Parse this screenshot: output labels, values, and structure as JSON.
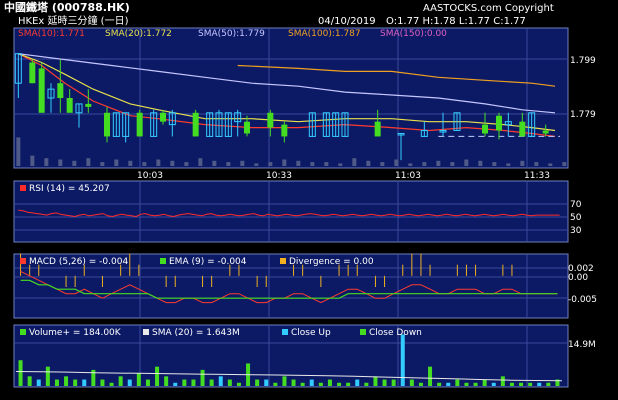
{
  "header": {
    "title": "中國鐵塔 (000788.HK)",
    "subtitle": "HKEx 延時三分鐘 (一日)",
    "copyright": "AASTOCKS.com Copyright",
    "date": "04/10/2019",
    "ohlc": "O:1.77  H:1.78  L:1.77  C:1.77"
  },
  "colors": {
    "background": "#000000",
    "panel": "#0c1a66",
    "grid": "#3a4a9a",
    "up_candle": "#33ccff",
    "down_candle": "#44dd22",
    "sma10": "#ff3b2e",
    "sma20": "#e8e04a",
    "sma50": "#c6c6ff",
    "sma100": "#f0a020",
    "sma150": "#e060c0",
    "rsi": "#ff2a2a",
    "macd": "#ff3b2e",
    "ema": "#44dd22",
    "divergence": "#f0b020",
    "volume_sma": "#e8e8e8",
    "text": "#ffffff"
  },
  "chart_data": [
    {
      "type": "candlestick",
      "title": "",
      "sma_legend": [
        {
          "label": "SMA(10):1.771",
          "color": "#ff3b2e"
        },
        {
          "label": "SMA(20):1.772",
          "color": "#e8e04a"
        },
        {
          "label": "SMA(50):1.779",
          "color": "#c6c6ff"
        },
        {
          "label": "SMA(100):1.787",
          "color": "#f0a020"
        },
        {
          "label": "SMA(150):0.00",
          "color": "#e060c0"
        }
      ],
      "x_ticks": [
        "10:03",
        "10:33",
        "11:03",
        "11:33"
      ],
      "y_ticks": [
        "1.799",
        "1.779"
      ],
      "ylim": [
        1.762,
        1.808
      ],
      "candles": [
        {
          "i": 0,
          "o": 1.79,
          "h": 1.8,
          "l": 1.785,
          "c": 1.8
        },
        {
          "i": 3,
          "o": 1.797,
          "h": 1.798,
          "l": 1.79,
          "c": 1.79
        },
        {
          "i": 5,
          "o": 1.795,
          "h": 1.797,
          "l": 1.78,
          "c": 1.78
        },
        {
          "i": 7,
          "o": 1.785,
          "h": 1.79,
          "l": 1.78,
          "c": 1.788
        },
        {
          "i": 9,
          "o": 1.79,
          "h": 1.798,
          "l": 1.78,
          "c": 1.785
        },
        {
          "i": 11,
          "o": 1.785,
          "h": 1.788,
          "l": 1.78,
          "c": 1.78
        },
        {
          "i": 13,
          "o": 1.78,
          "h": 1.783,
          "l": 1.775,
          "c": 1.783
        },
        {
          "i": 15,
          "o": 1.783,
          "h": 1.788,
          "l": 1.78,
          "c": 1.782
        },
        {
          "i": 19,
          "o": 1.78,
          "h": 1.782,
          "l": 1.77,
          "c": 1.772
        },
        {
          "i": 21,
          "o": 1.772,
          "h": 1.78,
          "l": 1.772,
          "c": 1.78
        },
        {
          "i": 23,
          "o": 1.772,
          "h": 1.78,
          "l": 1.77,
          "c": 1.78
        },
        {
          "i": 26,
          "o": 1.78,
          "h": 1.781,
          "l": 1.772,
          "c": 1.772
        },
        {
          "i": 29,
          "o": 1.772,
          "h": 1.781,
          "l": 1.772,
          "c": 1.78
        },
        {
          "i": 31,
          "o": 1.78,
          "h": 1.781,
          "l": 1.776,
          "c": 1.777
        },
        {
          "i": 33,
          "o": 1.776,
          "h": 1.781,
          "l": 1.772,
          "c": 1.78
        },
        {
          "i": 38,
          "o": 1.78,
          "h": 1.781,
          "l": 1.772,
          "c": 1.772
        },
        {
          "i": 41,
          "o": 1.772,
          "h": 1.78,
          "l": 1.772,
          "c": 1.78
        },
        {
          "i": 43,
          "o": 1.772,
          "h": 1.781,
          "l": 1.772,
          "c": 1.78
        },
        {
          "i": 45,
          "o": 1.772,
          "h": 1.78,
          "l": 1.772,
          "c": 1.78
        },
        {
          "i": 47,
          "o": 1.777,
          "h": 1.781,
          "l": 1.772,
          "c": 1.78
        },
        {
          "i": 49,
          "o": 1.777,
          "h": 1.779,
          "l": 1.772,
          "c": 1.773
        },
        {
          "i": 54,
          "o": 1.78,
          "h": 1.781,
          "l": 1.772,
          "c": 1.775
        },
        {
          "i": 57,
          "o": 1.776,
          "h": 1.777,
          "l": 1.77,
          "c": 1.772
        },
        {
          "i": 63,
          "o": 1.772,
          "h": 1.78,
          "l": 1.772,
          "c": 1.78
        },
        {
          "i": 66,
          "o": 1.772,
          "h": 1.78,
          "l": 1.772,
          "c": 1.78
        },
        {
          "i": 68,
          "o": 1.772,
          "h": 1.78,
          "l": 1.772,
          "c": 1.78
        },
        {
          "i": 70,
          "o": 1.772,
          "h": 1.78,
          "l": 1.772,
          "c": 1.78
        },
        {
          "i": 77,
          "o": 1.777,
          "h": 1.781,
          "l": 1.772,
          "c": 1.772
        },
        {
          "i": 82,
          "o": 1.773,
          "h": 1.773,
          "l": 1.764,
          "c": 1.773
        },
        {
          "i": 87,
          "o": 1.772,
          "h": 1.777,
          "l": 1.772,
          "c": 1.774
        },
        {
          "i": 91,
          "o": 1.774,
          "h": 1.78,
          "l": 1.772,
          "c": 1.774
        },
        {
          "i": 94,
          "o": 1.774,
          "h": 1.78,
          "l": 1.774,
          "c": 1.78
        },
        {
          "i": 100,
          "o": 1.776,
          "h": 1.78,
          "l": 1.772,
          "c": 1.773
        },
        {
          "i": 103,
          "o": 1.779,
          "h": 1.78,
          "l": 1.771,
          "c": 1.774
        },
        {
          "i": 105,
          "o": 1.776,
          "h": 1.78,
          "l": 1.772,
          "c": 1.777
        },
        {
          "i": 108,
          "o": 1.777,
          "h": 1.78,
          "l": 1.772,
          "c": 1.772
        },
        {
          "i": 110,
          "o": 1.772,
          "h": 1.78,
          "l": 1.772,
          "c": 1.78
        },
        {
          "i": 113,
          "o": 1.774,
          "h": 1.776,
          "l": 1.772,
          "c": 1.773
        }
      ],
      "sma_series": {
        "sma10": [
          [
            0,
            1.8
          ],
          [
            5,
            1.796
          ],
          [
            10,
            1.79
          ],
          [
            16,
            1.784
          ],
          [
            24,
            1.779
          ],
          [
            30,
            1.778
          ],
          [
            40,
            1.776
          ],
          [
            50,
            1.775
          ],
          [
            60,
            1.775
          ],
          [
            70,
            1.776
          ],
          [
            80,
            1.775
          ],
          [
            88,
            1.774
          ],
          [
            96,
            1.775
          ],
          [
            104,
            1.774
          ],
          [
            110,
            1.773
          ],
          [
            115,
            1.772
          ]
        ],
        "sma20": [
          [
            0,
            1.8
          ],
          [
            5,
            1.797
          ],
          [
            10,
            1.793
          ],
          [
            16,
            1.788
          ],
          [
            24,
            1.783
          ],
          [
            30,
            1.781
          ],
          [
            40,
            1.778
          ],
          [
            50,
            1.778
          ],
          [
            60,
            1.777
          ],
          [
            70,
            1.778
          ],
          [
            80,
            1.778
          ],
          [
            88,
            1.777
          ],
          [
            96,
            1.777
          ],
          [
            104,
            1.776
          ],
          [
            110,
            1.775
          ],
          [
            115,
            1.774
          ]
        ],
        "sma50": [
          [
            0,
            1.8
          ],
          [
            10,
            1.798
          ],
          [
            20,
            1.796
          ],
          [
            30,
            1.794
          ],
          [
            40,
            1.792
          ],
          [
            50,
            1.79
          ],
          [
            60,
            1.789
          ],
          [
            70,
            1.787
          ],
          [
            80,
            1.786
          ],
          [
            90,
            1.785
          ],
          [
            100,
            1.783
          ],
          [
            108,
            1.781
          ],
          [
            115,
            1.78
          ]
        ],
        "sma100": [
          [
            47,
            1.796
          ],
          [
            60,
            1.795
          ],
          [
            70,
            1.794
          ],
          [
            80,
            1.794
          ],
          [
            90,
            1.792
          ],
          [
            100,
            1.791
          ],
          [
            110,
            1.79
          ],
          [
            115,
            1.789
          ]
        ]
      },
      "dashed_level": 1.772,
      "volume_bars_hint": true
    },
    {
      "type": "line",
      "title": "RSI (14) = 45.207",
      "y_ticks": [
        70,
        50,
        30
      ],
      "ylim": [
        10,
        90
      ],
      "series": [
        {
          "name": "RSI (14)",
          "values": [
            52,
            51,
            49,
            48,
            47,
            46,
            45,
            47,
            48,
            46,
            45,
            44,
            43,
            45,
            46,
            44,
            45,
            46,
            47,
            44,
            43,
            45,
            46,
            45,
            44,
            43,
            46,
            47,
            45,
            44,
            45,
            46,
            44,
            43,
            45,
            46,
            47,
            46,
            45,
            44,
            46,
            47,
            45,
            44,
            45,
            46,
            45,
            44,
            45,
            46,
            47,
            45,
            44,
            46,
            45,
            44,
            45,
            46,
            45,
            44,
            45,
            46,
            47,
            46,
            45,
            44,
            45,
            46,
            45,
            44,
            45,
            46,
            45,
            44,
            45,
            46,
            45,
            44,
            45,
            46,
            45,
            44,
            45,
            46,
            45,
            44,
            45,
            46,
            45,
            44,
            45,
            46,
            45,
            44,
            45,
            46,
            45,
            44,
            45,
            46,
            45,
            44,
            45,
            46,
            45,
            44,
            45,
            46,
            45,
            44,
            45,
            45,
            45,
            45,
            45,
            45
          ]
        }
      ]
    },
    {
      "type": "line",
      "title_macd": "MACD (5,26) = -0.004",
      "title_ema": "EMA (9) = -0.004",
      "title_div": "Divergence = 0.00",
      "y_ticks": [
        "0.002",
        "0.00",
        "-0.005"
      ],
      "ylim": [
        -0.009,
        0.004
      ],
      "series": [
        {
          "name": "MACD (5,26)",
          "values": [
            0.001,
            0.0,
            -0.001,
            -0.002,
            -0.003,
            -0.004,
            -0.004,
            -0.003,
            -0.004,
            -0.005,
            -0.004,
            -0.003,
            -0.002,
            -0.003,
            -0.004,
            -0.005,
            -0.006,
            -0.006,
            -0.005,
            -0.005,
            -0.006,
            -0.006,
            -0.005,
            -0.004,
            -0.004,
            -0.005,
            -0.006,
            -0.006,
            -0.005,
            -0.005,
            -0.004,
            -0.004,
            -0.005,
            -0.006,
            -0.005,
            -0.004,
            -0.003,
            -0.003,
            -0.004,
            -0.005,
            -0.005,
            -0.004,
            -0.003,
            -0.002,
            -0.002,
            -0.003,
            -0.004,
            -0.004,
            -0.003,
            -0.003,
            -0.003,
            -0.004,
            -0.004,
            -0.003,
            -0.003,
            -0.004,
            -0.004,
            -0.004,
            -0.004,
            -0.004
          ]
        },
        {
          "name": "EMA (9)",
          "values": [
            -0.001,
            -0.001,
            -0.002,
            -0.002,
            -0.003,
            -0.003,
            -0.003,
            -0.004,
            -0.004,
            -0.004,
            -0.004,
            -0.004,
            -0.004,
            -0.004,
            -0.004,
            -0.005,
            -0.005,
            -0.005,
            -0.005,
            -0.005,
            -0.005,
            -0.005,
            -0.005,
            -0.005,
            -0.005,
            -0.005,
            -0.005,
            -0.005,
            -0.005,
            -0.005,
            -0.005,
            -0.005,
            -0.005,
            -0.005,
            -0.005,
            -0.005,
            -0.004,
            -0.004,
            -0.004,
            -0.004,
            -0.004,
            -0.004,
            -0.004,
            -0.004,
            -0.004,
            -0.004,
            -0.004,
            -0.004,
            -0.004,
            -0.004,
            -0.004,
            -0.004,
            -0.004,
            -0.004,
            -0.004,
            -0.004,
            -0.004,
            -0.004,
            -0.004,
            -0.004
          ]
        }
      ]
    },
    {
      "type": "bar",
      "title_volume": "Volume+ = 184.00K",
      "title_sma": "SMA (20) = 1.643M",
      "legend_up": "Close Up",
      "legend_down": "Close Down",
      "y_ticks": [
        "14.9M"
      ],
      "ylim": [
        0,
        18
      ],
      "volume_sma_values": [
        4.5,
        4.4,
        4.3,
        4.1,
        4.0,
        3.9,
        3.8,
        3.7,
        3.6,
        3.5,
        3.4,
        3.3,
        3.2,
        3.0,
        2.8,
        2.6,
        2.4,
        2.2,
        2.0,
        1.8,
        1.7,
        1.6
      ]
    }
  ]
}
